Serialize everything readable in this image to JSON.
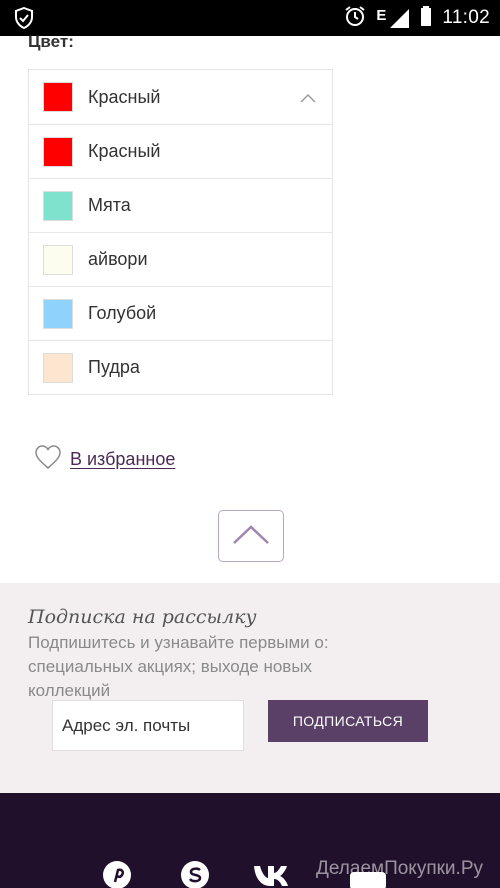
{
  "status_bar": {
    "time": "11:02",
    "network": "E"
  },
  "color_section": {
    "label": "Цвет:",
    "selected": {
      "name": "Красный",
      "color": "#ff0000"
    },
    "options": [
      {
        "name": "Красный",
        "color": "#ff0000"
      },
      {
        "name": "Мята",
        "color": "#7fe2cc"
      },
      {
        "name": "айвори",
        "color": "#fdfdef"
      },
      {
        "name": "Голубой",
        "color": "#8fd3fb"
      },
      {
        "name": "Пудра",
        "color": "#fde6cf"
      }
    ]
  },
  "favorites": {
    "label": "В избранное"
  },
  "newsletter": {
    "title": "Подписка на рассылку",
    "description": "Подпишитесь и узнавайте первыми о: специальных акциях; выходе новых коллекций",
    "email_placeholder": "Адрес эл. почты",
    "subscribe_label": "ПОДПИСАТЬСЯ"
  },
  "footer": {
    "social_icons": [
      "pinterest-icon",
      "skype-icon",
      "vk-icon",
      "youtube-icon"
    ],
    "watermark": "ДелаемПокупки.Ру"
  },
  "colors": {
    "accent": "#5a3f66",
    "footer_bg": "#21102c",
    "newsletter_bg": "#f3eff0"
  }
}
